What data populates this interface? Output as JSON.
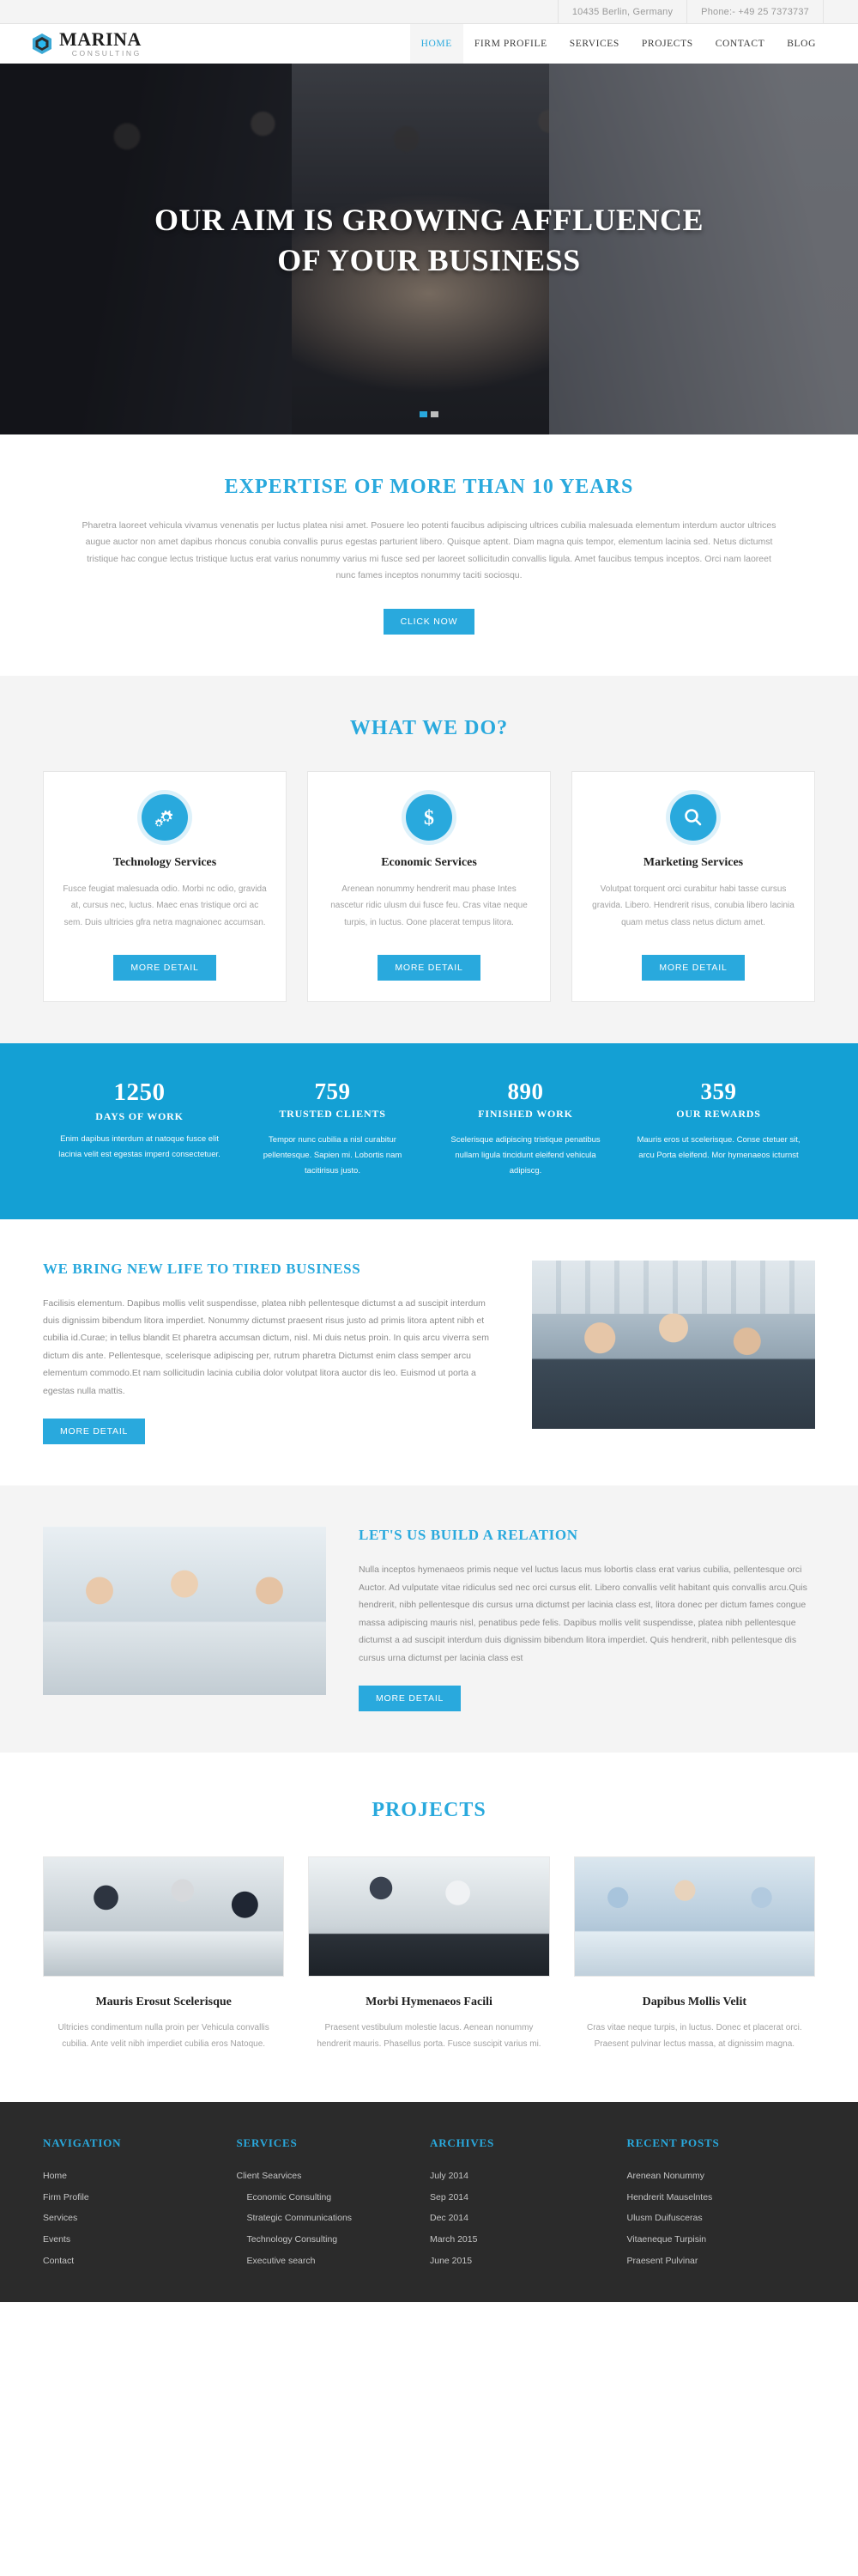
{
  "brand": {
    "name": "MARINA",
    "tagline": "CONSULTING",
    "accent": "#29a9dd"
  },
  "topbar": {
    "address": "10435 Berlin, Germany",
    "phone": "Phone:- +49 25 7373737"
  },
  "nav": {
    "items": [
      {
        "label": "HOME",
        "active": true
      },
      {
        "label": "FIRM PROFILE",
        "active": false
      },
      {
        "label": "SERVICES",
        "active": false
      },
      {
        "label": "PROJECTS",
        "active": false
      },
      {
        "label": "CONTACT",
        "active": false
      },
      {
        "label": "BLOG",
        "active": false
      }
    ]
  },
  "hero": {
    "line1": "OUR AIM IS GROWING AFFLUENCE",
    "line2": "OF YOUR BUSINESS",
    "slides": 2,
    "active_slide": 1
  },
  "expertise": {
    "title": "EXPERTISE OF MORE THAN 10 YEARS",
    "body": "Pharetra laoreet vehicula vivamus venenatis per luctus platea nisi amet. Posuere leo potenti faucibus adipiscing ultrices cubilia malesuada elementum interdum auctor ultrices augue auctor non amet dapibus rhoncus conubia convallis purus egestas parturient libero. Quisque aptent. Diam magna quis tempor, elementum lacinia sed. Netus dictumst tristique hac congue lectus tristique luctus erat varius nonummy varius mi fusce sed per laoreet sollicitudin convallis ligula. Amet faucibus tempus inceptos. Orci nam laoreet nunc fames inceptos nonummy taciti sociosqu.",
    "cta": "CLICK NOW"
  },
  "whatwedo": {
    "title": "WHAT WE DO?",
    "cards": [
      {
        "icon": "gears-icon",
        "title": "Technology Services",
        "text": "Fusce feugiat malesuada odio. Morbi nc odio, gravida at, cursus nec, luctus. Maec enas tristique orci ac sem. Duis ultricies gfra netra magnaionec accumsan.",
        "cta": "MORE DETAIL"
      },
      {
        "icon": "dollar-icon",
        "title": "Economic Services",
        "text": "Arenean nonummy hendrerit mau phase Intes nascetur ridic ulusm dui fusce feu. Cras vitae neque turpis, in luctus. Oone placerat tempus litora.",
        "cta": "MORE DETAIL"
      },
      {
        "icon": "search-icon",
        "title": "Marketing Services",
        "text": "Volutpat torquent orci curabitur habi tasse cursus gravida. Libero. Hendrerit risus, conubia libero lacinia quam metus class netus dictum amet.",
        "cta": "MORE DETAIL"
      }
    ]
  },
  "stats": [
    {
      "number": "1250",
      "label": "DAYS OF WORK",
      "text": "Enim dapibus interdum at natoque fusce elit lacinia velit est egestas imperd consectetuer."
    },
    {
      "number": "759",
      "label": "TRUSTED CLIENTS",
      "text": "Tempor nunc cubilia a nisl curabitur pellentesque. Sapien mi. Lobortis nam tacitirisus justo."
    },
    {
      "number": "890",
      "label": "FINISHED WORK",
      "text": "Scelerisque adipiscing tristique penatibus nullam ligula tincidunt eleifend vehicula adipiscg."
    },
    {
      "number": "359",
      "label": "OUR REWARDS",
      "text": "Mauris eros ut scelerisque. Conse ctetuer sit, arcu Porta eleifend. Mor hymenaeos icturnst"
    }
  ],
  "newlife": {
    "title": "WE BRING NEW LIFE TO TIRED BUSINESS",
    "text": "Facilisis elementum. Dapibus mollis velit suspendisse, platea nibh pellentesque dictumst a ad suscipit interdum duis dignissim bibendum litora imperdiet. Nonummy dictumst praesent risus justo ad primis litora aptent nibh et cubilia id.Curae; in tellus blandit Et pharetra accumsan dictum, nisl. Mi duis netus proin. In quis arcu viverra sem dictum dis ante. Pellentesque, scelerisque adipiscing per, rutrum pharetra Dictumst enim class semper arcu elementum commodo.Et nam sollicitudin lacinia cubilia dolor volutpat litora auctor dis leo. Euismod ut porta a egestas nulla mattis.",
    "cta": "MORE DETAIL",
    "image": "office-team-photo"
  },
  "relation": {
    "title": "LET'S US BUILD A RELATION",
    "text": "Nulla inceptos hymenaeos primis neque vel luctus lacus mus lobortis class erat varius cubilia, pellentesque orci Auctor. Ad vulputate vitae ridiculus sed nec orci cursus elit. Libero convallis velit habitant quis convallis arcu.Quis hendrerit, nibh pellentesque dis cursus urna dictumst per lacinia class est, litora donec per dictum fames congue massa adipiscing mauris nisl, penatibus pede felis. Dapibus mollis velit suspendisse, platea nibh pellentesque dictumst a ad suscipit interdum duis dignissim bibendum litora imperdiet. Quis hendrerit, nibh pellentesque dis cursus urna dictumst per lacinia class est",
    "cta": "MORE DETAIL",
    "image": "team-blueprint-photo"
  },
  "projects": {
    "title": "PROJECTS",
    "items": [
      {
        "title": "Mauris Erosut Scelerisque",
        "text": "Ultricies condimentum nulla proin per Vehicula convallis cubilia. Ante velit nibh imperdiet cubilia eros Natoque.",
        "image": "meeting-photo-1"
      },
      {
        "title": "Morbi Hymenaeos Facili",
        "text": "Praesent vestibulum molestie lacus. Aenean nonummy hendrerit mauris. Phasellus porta. Fusce suscipit varius mi.",
        "image": "meeting-photo-2"
      },
      {
        "title": "Dapibus Mollis Velit",
        "text": "Cras vitae neque turpis, in luctus. Donec et placerat orci. Praesent pulvinar lectus massa, at dignissim magna.",
        "image": "meeting-photo-3"
      }
    ]
  },
  "footer": {
    "columns": [
      {
        "heading": "NAVIGATION",
        "items": [
          "Home",
          "Firm Profile",
          "Services",
          "Events",
          "Contact"
        ]
      },
      {
        "heading": "SERVICES",
        "items": [
          "Client Searvices",
          "Economic Consulting",
          "Strategic Communications",
          "Technology Consulting",
          "Executive search"
        ]
      },
      {
        "heading": "ARCHIVES",
        "items": [
          "July 2014",
          "Sep 2014",
          "Dec 2014",
          "March 2015",
          "June 2015"
        ]
      },
      {
        "heading": "RECENT POSTS",
        "items": [
          "Arenean Nonummy",
          "Hendrerit Mauselntes",
          "Ulusm Duifusceras",
          "Vitaeneque Turpisin",
          "Praesent Pulvinar"
        ]
      }
    ]
  }
}
